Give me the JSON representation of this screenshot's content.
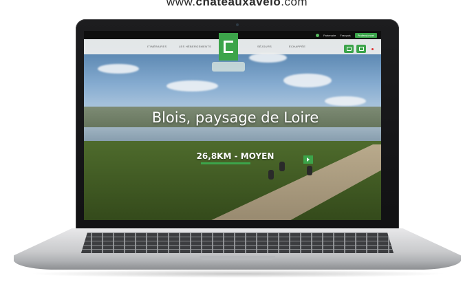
{
  "caption": {
    "prefix": "www.",
    "brand": "chateauxavelo",
    "suffix": ".com"
  },
  "site": {
    "topbar": {
      "link_1": "Partenaire",
      "link_2": "Français",
      "pro_button": "Professionnel"
    },
    "nav": {
      "item_1": "ITINÉRAIRES",
      "item_2": "LES HÉBERGEMENTS",
      "item_3": "SÉJOURS",
      "item_4": "ÉCHAPPÉE"
    },
    "hero": {
      "title": "Blois, paysage de Loire",
      "subtitle": "26,8KM - MOYEN"
    }
  },
  "colors": {
    "accent_green": "#3ca44a",
    "bezel": "#151517"
  }
}
